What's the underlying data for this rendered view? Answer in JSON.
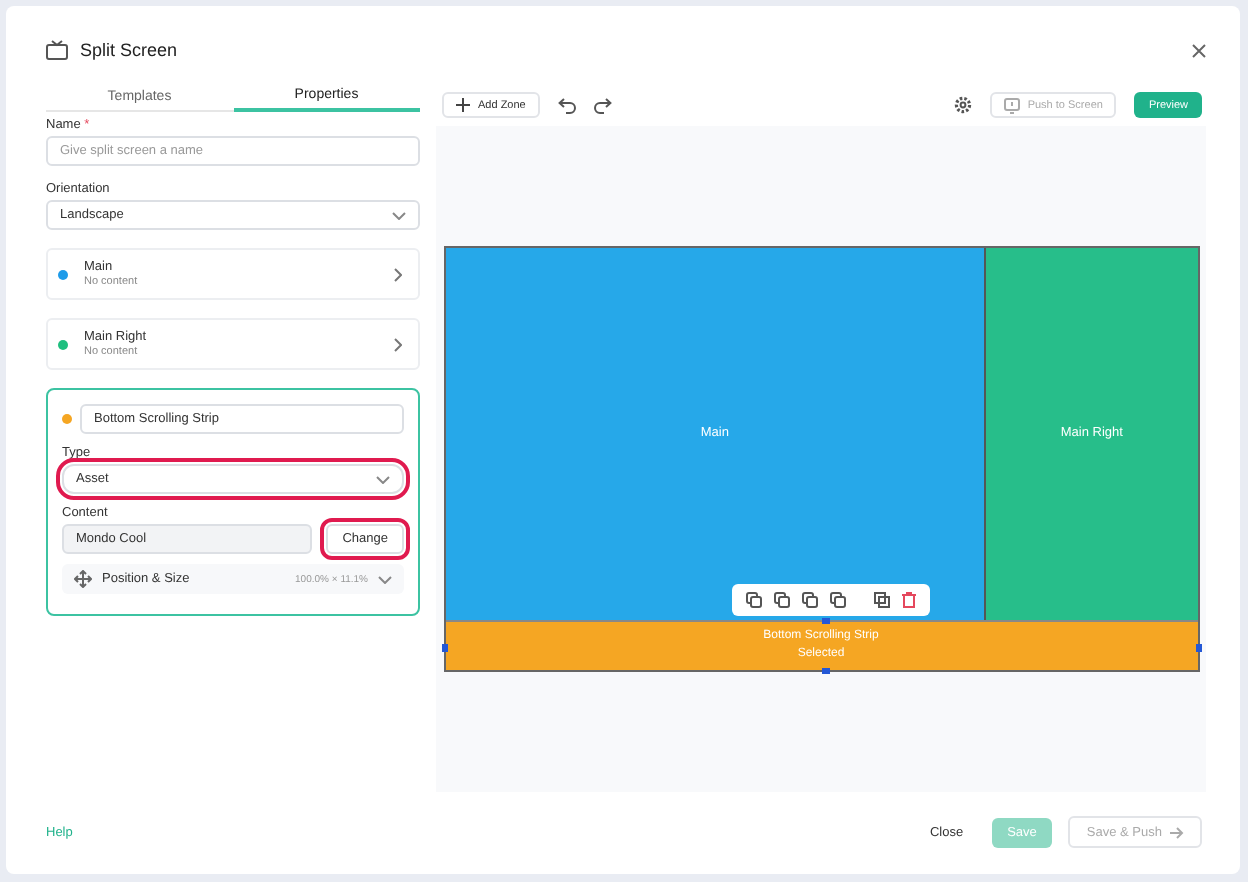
{
  "window": {
    "title": "Split Screen"
  },
  "tabs": [
    {
      "label": "Templates",
      "selected": false
    },
    {
      "label": "Properties",
      "selected": true
    }
  ],
  "name_field": {
    "label": "Name",
    "required_mark": "*",
    "placeholder": "Give split screen a name"
  },
  "orientation": {
    "label": "Orientation",
    "value": "Landscape"
  },
  "zone_list": [
    {
      "name": "Main",
      "subtitle": "No content",
      "color": "#1e9be9"
    },
    {
      "name": "Main Right",
      "subtitle": "No content",
      "color": "#1fbf7f"
    }
  ],
  "editing_zone": {
    "name": "Bottom Scrolling Strip",
    "color": "#f5a623",
    "type_label": "Type",
    "type_value": "Asset",
    "type_highlighted": true,
    "content_label": "Content",
    "content_value": "Mondo Cool",
    "change_button": "Change",
    "change_highlighted": true,
    "position_label": "Position & Size",
    "position_value": "100.0% × 11.1%"
  },
  "toolbar": {
    "add_zone": "Add Zone",
    "push_to_screen": {
      "label": "Push to Screen",
      "disabled": true
    },
    "preview": "Preview"
  },
  "canvas_zones": [
    {
      "label": "Main",
      "color": "#26a8e9",
      "selected": false,
      "kind": "zone"
    },
    {
      "label": "Main Right",
      "color": "#27be8a",
      "selected": false,
      "kind": "zone"
    },
    {
      "label": "Bottom Scrolling Strip",
      "color": "#f5a623",
      "selected": true,
      "status": "Selected",
      "kind": "strip"
    }
  ],
  "footer": {
    "help": "Help",
    "close": "Close",
    "save": {
      "label": "Save",
      "disabled": true
    },
    "save_push": {
      "label": "Save & Push",
      "disabled": true
    }
  }
}
